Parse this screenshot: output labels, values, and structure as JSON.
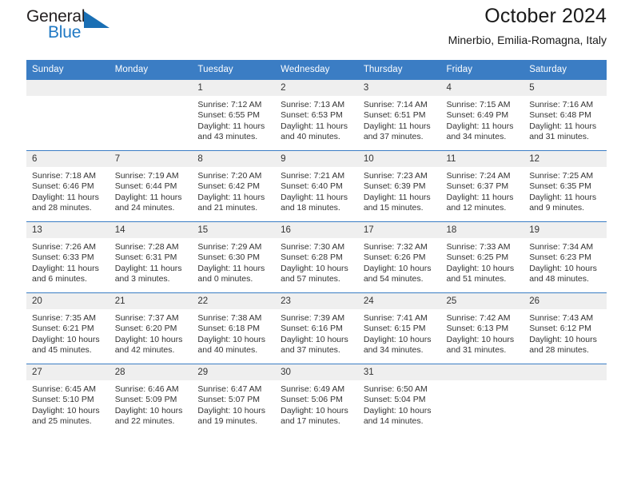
{
  "brand": {
    "name_top": "General",
    "name_bottom": "Blue",
    "flag_icon": "triangle-flag-icon",
    "accent_color": "#2079c4"
  },
  "header": {
    "title": "October 2024",
    "subtitle": "Minerbio, Emilia-Romagna, Italy"
  },
  "calendar": {
    "header_bg": "#3b7dc4",
    "daynum_bg": "#efefef",
    "weekdays": [
      "Sunday",
      "Monday",
      "Tuesday",
      "Wednesday",
      "Thursday",
      "Friday",
      "Saturday"
    ],
    "weeks": [
      [
        {
          "day": "",
          "lines": []
        },
        {
          "day": "",
          "lines": []
        },
        {
          "day": "1",
          "lines": [
            "Sunrise: 7:12 AM",
            "Sunset: 6:55 PM",
            "Daylight: 11 hours",
            "and 43 minutes."
          ]
        },
        {
          "day": "2",
          "lines": [
            "Sunrise: 7:13 AM",
            "Sunset: 6:53 PM",
            "Daylight: 11 hours",
            "and 40 minutes."
          ]
        },
        {
          "day": "3",
          "lines": [
            "Sunrise: 7:14 AM",
            "Sunset: 6:51 PM",
            "Daylight: 11 hours",
            "and 37 minutes."
          ]
        },
        {
          "day": "4",
          "lines": [
            "Sunrise: 7:15 AM",
            "Sunset: 6:49 PM",
            "Daylight: 11 hours",
            "and 34 minutes."
          ]
        },
        {
          "day": "5",
          "lines": [
            "Sunrise: 7:16 AM",
            "Sunset: 6:48 PM",
            "Daylight: 11 hours",
            "and 31 minutes."
          ]
        }
      ],
      [
        {
          "day": "6",
          "lines": [
            "Sunrise: 7:18 AM",
            "Sunset: 6:46 PM",
            "Daylight: 11 hours",
            "and 28 minutes."
          ]
        },
        {
          "day": "7",
          "lines": [
            "Sunrise: 7:19 AM",
            "Sunset: 6:44 PM",
            "Daylight: 11 hours",
            "and 24 minutes."
          ]
        },
        {
          "day": "8",
          "lines": [
            "Sunrise: 7:20 AM",
            "Sunset: 6:42 PM",
            "Daylight: 11 hours",
            "and 21 minutes."
          ]
        },
        {
          "day": "9",
          "lines": [
            "Sunrise: 7:21 AM",
            "Sunset: 6:40 PM",
            "Daylight: 11 hours",
            "and 18 minutes."
          ]
        },
        {
          "day": "10",
          "lines": [
            "Sunrise: 7:23 AM",
            "Sunset: 6:39 PM",
            "Daylight: 11 hours",
            "and 15 minutes."
          ]
        },
        {
          "day": "11",
          "lines": [
            "Sunrise: 7:24 AM",
            "Sunset: 6:37 PM",
            "Daylight: 11 hours",
            "and 12 minutes."
          ]
        },
        {
          "day": "12",
          "lines": [
            "Sunrise: 7:25 AM",
            "Sunset: 6:35 PM",
            "Daylight: 11 hours",
            "and 9 minutes."
          ]
        }
      ],
      [
        {
          "day": "13",
          "lines": [
            "Sunrise: 7:26 AM",
            "Sunset: 6:33 PM",
            "Daylight: 11 hours",
            "and 6 minutes."
          ]
        },
        {
          "day": "14",
          "lines": [
            "Sunrise: 7:28 AM",
            "Sunset: 6:31 PM",
            "Daylight: 11 hours",
            "and 3 minutes."
          ]
        },
        {
          "day": "15",
          "lines": [
            "Sunrise: 7:29 AM",
            "Sunset: 6:30 PM",
            "Daylight: 11 hours",
            "and 0 minutes."
          ]
        },
        {
          "day": "16",
          "lines": [
            "Sunrise: 7:30 AM",
            "Sunset: 6:28 PM",
            "Daylight: 10 hours",
            "and 57 minutes."
          ]
        },
        {
          "day": "17",
          "lines": [
            "Sunrise: 7:32 AM",
            "Sunset: 6:26 PM",
            "Daylight: 10 hours",
            "and 54 minutes."
          ]
        },
        {
          "day": "18",
          "lines": [
            "Sunrise: 7:33 AM",
            "Sunset: 6:25 PM",
            "Daylight: 10 hours",
            "and 51 minutes."
          ]
        },
        {
          "day": "19",
          "lines": [
            "Sunrise: 7:34 AM",
            "Sunset: 6:23 PM",
            "Daylight: 10 hours",
            "and 48 minutes."
          ]
        }
      ],
      [
        {
          "day": "20",
          "lines": [
            "Sunrise: 7:35 AM",
            "Sunset: 6:21 PM",
            "Daylight: 10 hours",
            "and 45 minutes."
          ]
        },
        {
          "day": "21",
          "lines": [
            "Sunrise: 7:37 AM",
            "Sunset: 6:20 PM",
            "Daylight: 10 hours",
            "and 42 minutes."
          ]
        },
        {
          "day": "22",
          "lines": [
            "Sunrise: 7:38 AM",
            "Sunset: 6:18 PM",
            "Daylight: 10 hours",
            "and 40 minutes."
          ]
        },
        {
          "day": "23",
          "lines": [
            "Sunrise: 7:39 AM",
            "Sunset: 6:16 PM",
            "Daylight: 10 hours",
            "and 37 minutes."
          ]
        },
        {
          "day": "24",
          "lines": [
            "Sunrise: 7:41 AM",
            "Sunset: 6:15 PM",
            "Daylight: 10 hours",
            "and 34 minutes."
          ]
        },
        {
          "day": "25",
          "lines": [
            "Sunrise: 7:42 AM",
            "Sunset: 6:13 PM",
            "Daylight: 10 hours",
            "and 31 minutes."
          ]
        },
        {
          "day": "26",
          "lines": [
            "Sunrise: 7:43 AM",
            "Sunset: 6:12 PM",
            "Daylight: 10 hours",
            "and 28 minutes."
          ]
        }
      ],
      [
        {
          "day": "27",
          "lines": [
            "Sunrise: 6:45 AM",
            "Sunset: 5:10 PM",
            "Daylight: 10 hours",
            "and 25 minutes."
          ]
        },
        {
          "day": "28",
          "lines": [
            "Sunrise: 6:46 AM",
            "Sunset: 5:09 PM",
            "Daylight: 10 hours",
            "and 22 minutes."
          ]
        },
        {
          "day": "29",
          "lines": [
            "Sunrise: 6:47 AM",
            "Sunset: 5:07 PM",
            "Daylight: 10 hours",
            "and 19 minutes."
          ]
        },
        {
          "day": "30",
          "lines": [
            "Sunrise: 6:49 AM",
            "Sunset: 5:06 PM",
            "Daylight: 10 hours",
            "and 17 minutes."
          ]
        },
        {
          "day": "31",
          "lines": [
            "Sunrise: 6:50 AM",
            "Sunset: 5:04 PM",
            "Daylight: 10 hours",
            "and 14 minutes."
          ]
        },
        {
          "day": "",
          "lines": []
        },
        {
          "day": "",
          "lines": []
        }
      ]
    ]
  }
}
